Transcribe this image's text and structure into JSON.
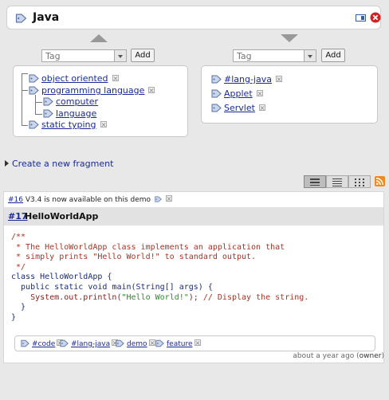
{
  "page": {
    "title": "Java"
  },
  "left_box": {
    "placeholder": "Tag",
    "add_label": "Add",
    "tree": [
      {
        "label": "object oriented"
      },
      {
        "label": "programming language",
        "children": [
          {
            "label": "computer"
          },
          {
            "label": "language"
          }
        ]
      },
      {
        "label": "static typing"
      }
    ]
  },
  "right_box": {
    "placeholder": "Tag",
    "add_label": "Add",
    "tags": [
      {
        "label": "#lang-java"
      },
      {
        "label": "Applet"
      },
      {
        "label": "Servlet"
      }
    ]
  },
  "create_fragment": {
    "label": "Create a new fragment"
  },
  "view_buttons": [
    "list-view-icon",
    "compact-view-icon",
    "grid-view-icon",
    "rss-icon"
  ],
  "notice": {
    "id": "#16",
    "text": " V3.4 is now available on this demo"
  },
  "fragment": {
    "id": "#17",
    "title": "HelloWorldApp",
    "code_lines": [
      "/**",
      " * The HelloWorldApp class implements an application that",
      " * simply prints \"Hello World!\" to standard output.",
      " */",
      "class HelloWorldApp {",
      "  public static void main(String[] args) {",
      "    System.out.println(\"Hello World!\"); // Display the string.",
      "  }",
      "}"
    ],
    "code": {
      "l1": "/**",
      "l2": " * The HelloWorldApp class implements an application that",
      "l3": " * simply prints \"Hello World!\" to standard output.",
      "l4": " */",
      "l5": "class HelloWorldApp {",
      "l6": "  public static void main(String[] args) {",
      "l7a": "    System.out.println(",
      "l7b": "\"Hello World!\"",
      "l7c": "); ",
      "l7d": "// Display the string.",
      "l8": "  }",
      "l9": "}"
    },
    "tags": [
      "#code",
      "#lang-java",
      "demo",
      "feature"
    ],
    "meta": {
      "time": "about a year ago",
      "owner": "owner"
    }
  },
  "colors": {
    "link": "#1a2a9a",
    "close": "#d42020",
    "header_bg": "#e2e2e2",
    "background": "#e8e8e8",
    "rss": "#f08a1c"
  }
}
